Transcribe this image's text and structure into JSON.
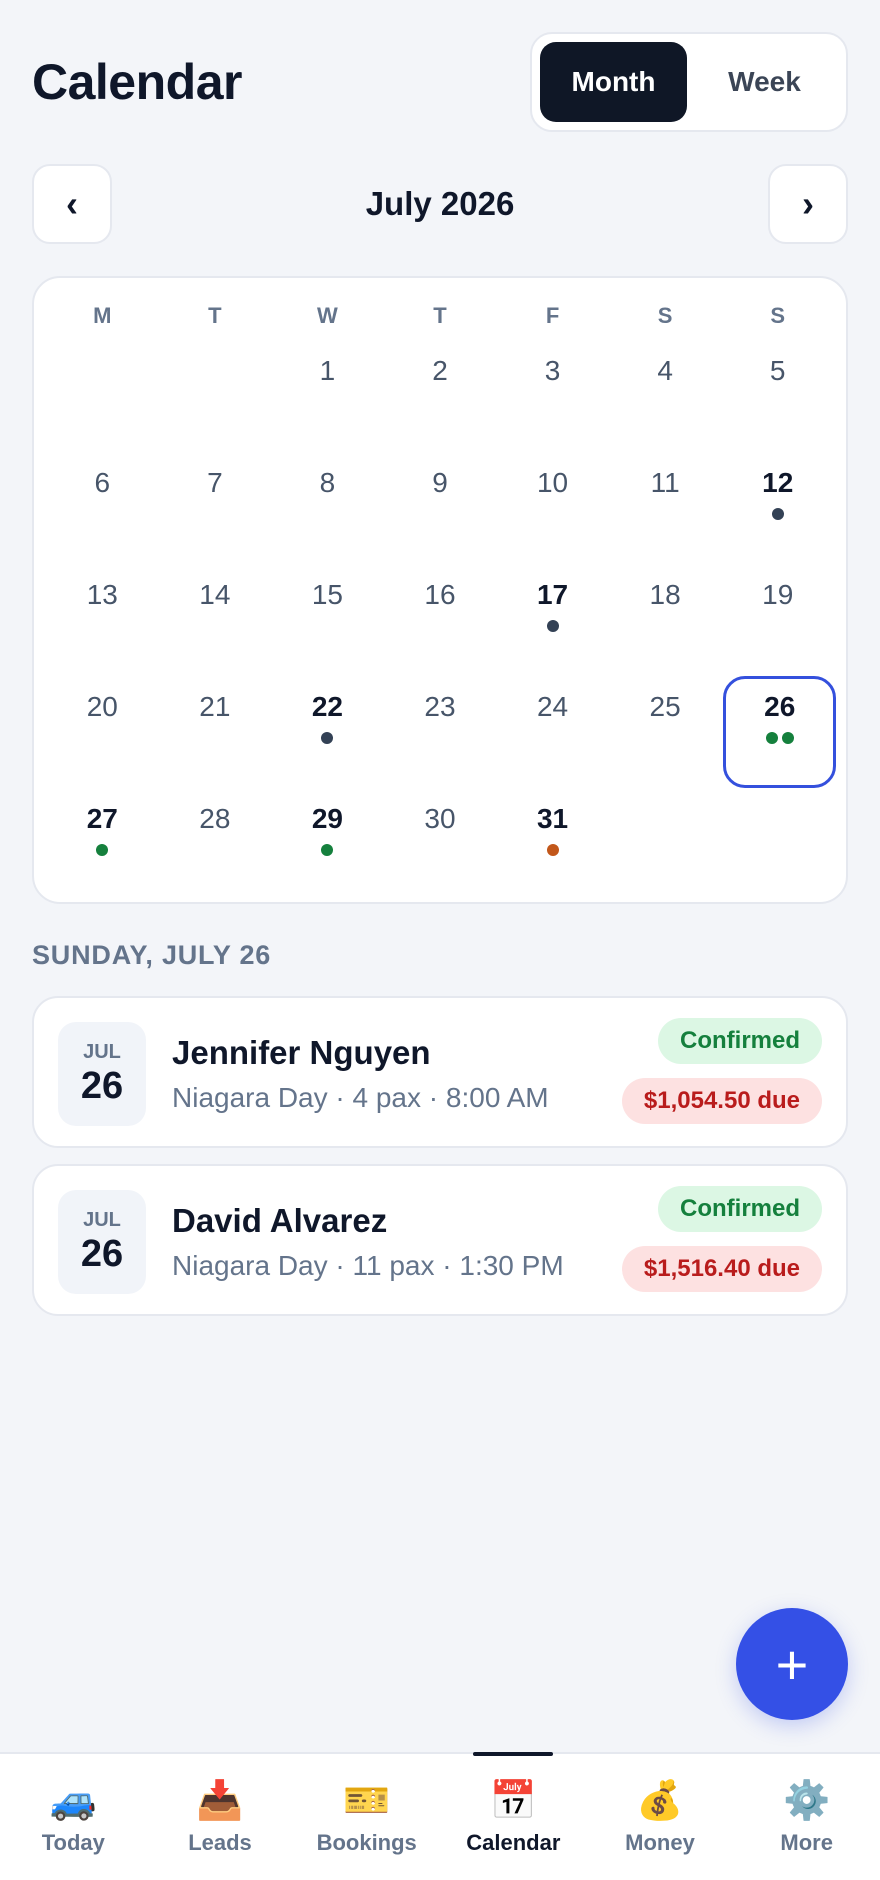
{
  "header": {
    "title": "Calendar",
    "view_toggle": {
      "month": "Month",
      "week": "Week",
      "active": "month"
    }
  },
  "month_nav": {
    "prev": "‹",
    "next": "›",
    "label": "July 2026"
  },
  "colors": {
    "accent": "#3450e6",
    "dot_dark": "#334155",
    "dot_green": "#15803d",
    "dot_orange": "#c2571a",
    "confirmed_bg": "#dcf7e4",
    "due_bg": "#fde1e1"
  },
  "calendar": {
    "weekdays": [
      "M",
      "T",
      "W",
      "T",
      "F",
      "S",
      "S"
    ],
    "leading_blanks": 2,
    "selected_day": 26,
    "days": [
      {
        "day": "1"
      },
      {
        "day": "2"
      },
      {
        "day": "3"
      },
      {
        "day": "4"
      },
      {
        "day": "5"
      },
      {
        "day": "6"
      },
      {
        "day": "7"
      },
      {
        "day": "8"
      },
      {
        "day": "9"
      },
      {
        "day": "10"
      },
      {
        "day": "11"
      },
      {
        "day": "12",
        "dots": [
          "dark"
        ]
      },
      {
        "day": "13"
      },
      {
        "day": "14"
      },
      {
        "day": "15"
      },
      {
        "day": "16"
      },
      {
        "day": "17",
        "dots": [
          "dark"
        ]
      },
      {
        "day": "18"
      },
      {
        "day": "19"
      },
      {
        "day": "20"
      },
      {
        "day": "21"
      },
      {
        "day": "22",
        "dots": [
          "dark"
        ]
      },
      {
        "day": "23"
      },
      {
        "day": "24"
      },
      {
        "day": "25"
      },
      {
        "day": "26",
        "dots": [
          "green",
          "green"
        ]
      },
      {
        "day": "27",
        "dots": [
          "green"
        ]
      },
      {
        "day": "28"
      },
      {
        "day": "29",
        "dots": [
          "green"
        ]
      },
      {
        "day": "30"
      },
      {
        "day": "31",
        "dots": [
          "orange"
        ]
      }
    ]
  },
  "agenda": {
    "heading": "SUNDAY, JULY 26",
    "bookings": [
      {
        "month": "JUL",
        "day": "26",
        "name": "Jennifer Nguyen",
        "details": "Niagara Day · 4 pax · 8:00 AM",
        "status": "Confirmed",
        "due": "$1,054.50 due"
      },
      {
        "month": "JUL",
        "day": "26",
        "name": "David Alvarez",
        "details": "Niagara Day · 11 pax · 1:30 PM",
        "status": "Confirmed",
        "due": "$1,516.40 due"
      }
    ]
  },
  "fab": {
    "label": "+"
  },
  "bottom_nav": {
    "active": "calendar",
    "items": [
      {
        "id": "today",
        "label": "Today",
        "icon": "🚙",
        "icon_name": "car-icon"
      },
      {
        "id": "leads",
        "label": "Leads",
        "icon": "📥",
        "icon_name": "inbox-icon"
      },
      {
        "id": "bookings",
        "label": "Bookings",
        "icon": "🎫",
        "icon_name": "ticket-icon"
      },
      {
        "id": "calendar",
        "label": "Calendar",
        "icon": "📅",
        "icon_name": "calendar-icon"
      },
      {
        "id": "money",
        "label": "Money",
        "icon": "💰",
        "icon_name": "money-bag-icon"
      },
      {
        "id": "more",
        "label": "More",
        "icon": "⚙️",
        "icon_name": "gear-icon"
      }
    ]
  }
}
